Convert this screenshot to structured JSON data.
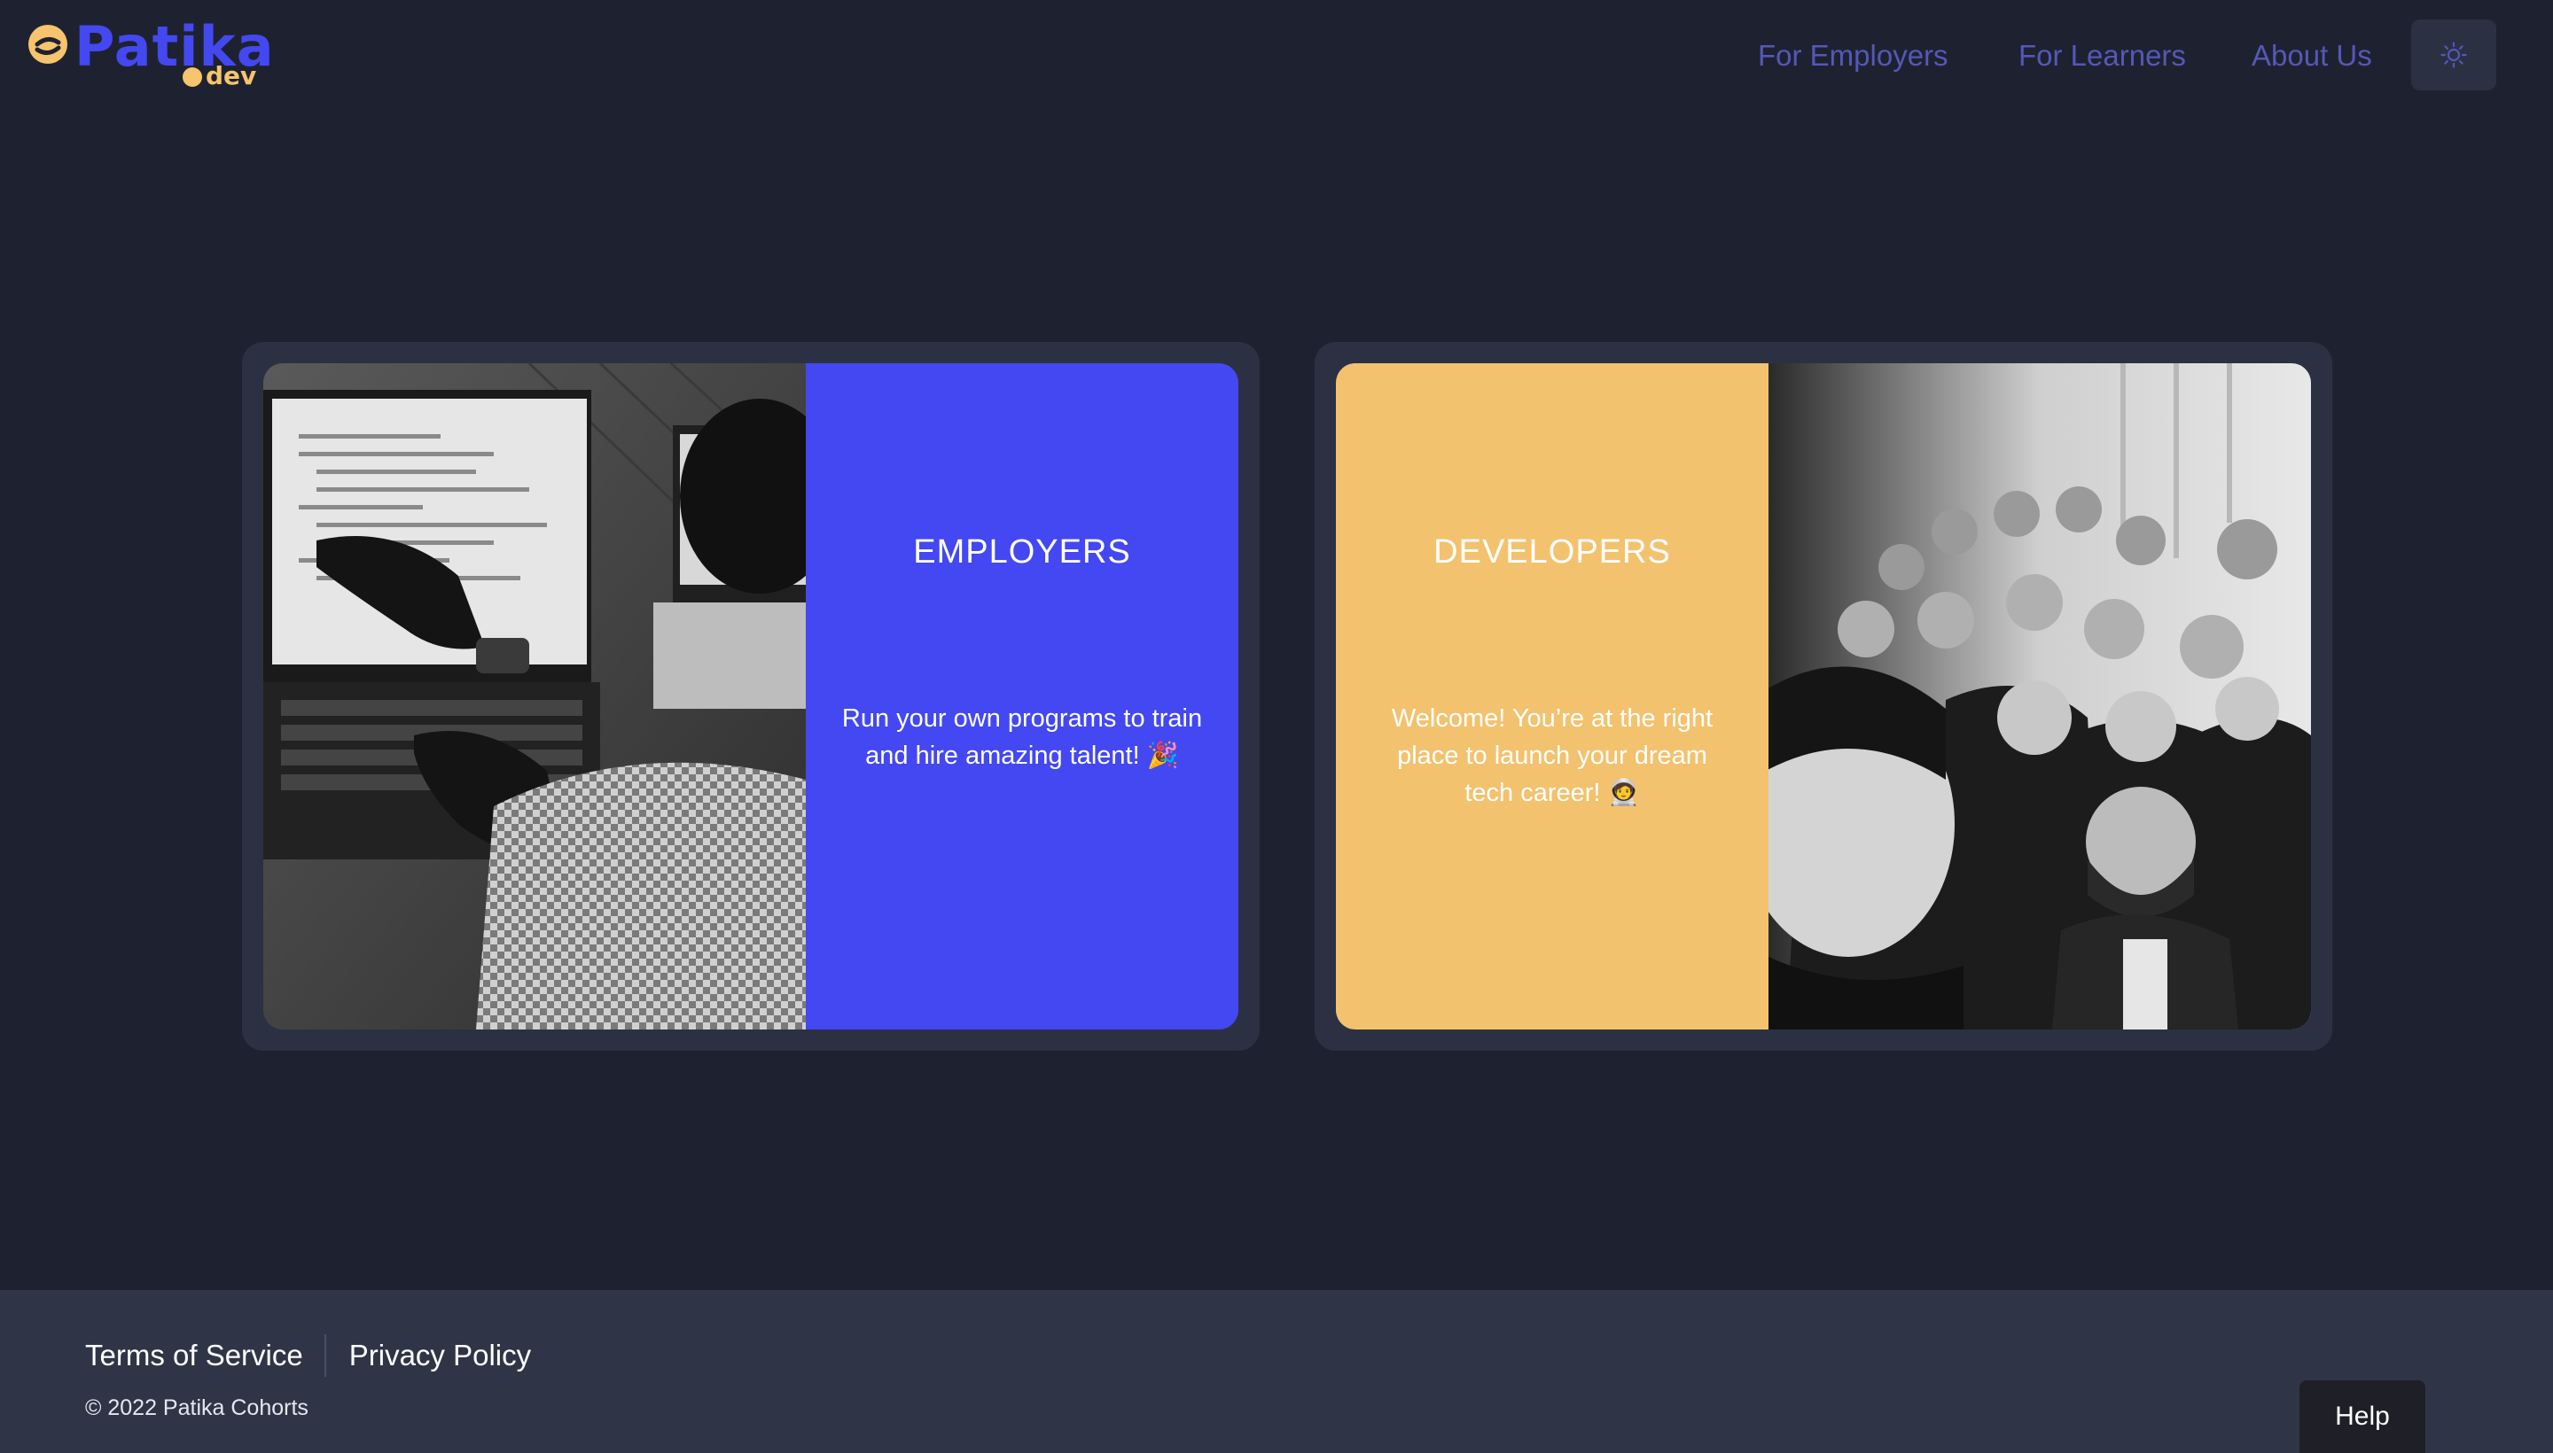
{
  "brand": {
    "name": "Patika",
    "suffix": "dev",
    "primary_color": "#4448f0",
    "accent_color": "#f5c46c"
  },
  "nav": {
    "items": [
      {
        "label": "For Employers"
      },
      {
        "label": "For Learners"
      },
      {
        "label": "About Us"
      }
    ],
    "theme_toggle_icon": "sun-icon"
  },
  "cards": {
    "employers": {
      "title": "EMPLOYERS",
      "text": "Run your own programs to train and hire amazing talent! 🎉",
      "color": "#4348f2",
      "image": "laptop-coding-photo"
    },
    "developers": {
      "title": "DEVELOPERS",
      "text": "Welcome! You’re at the right place to launch your dream tech career! 🧑‍🚀",
      "color": "#f3c26e",
      "image": "group-selfie-photo"
    }
  },
  "footer": {
    "terms": "Terms of Service",
    "privacy": "Privacy Policy",
    "copyright": "© 2022 Patika Cohorts"
  },
  "help": {
    "label": "Help"
  }
}
